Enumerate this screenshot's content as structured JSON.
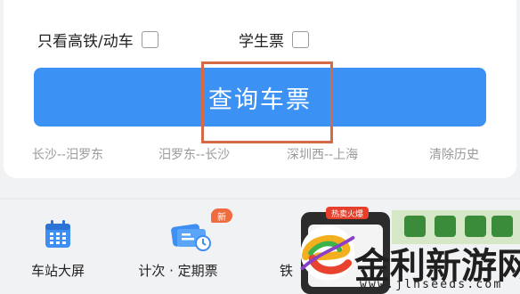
{
  "options": {
    "high_speed_only_label": "只看高铁/动车",
    "student_ticket_label": "学生票"
  },
  "query_button_label": "查询车票",
  "history": [
    "长沙--汨罗东",
    "汨罗东--长沙",
    "深圳西--上海",
    "清除历史"
  ],
  "tools": [
    {
      "label": "车站大屏",
      "icon": "calendar-icon"
    },
    {
      "label": "计次 · 定期票",
      "icon": "ticket-card-icon",
      "badge": "新"
    },
    {
      "label": "铁",
      "icon": "ad-thumbnail",
      "badge": "热卖火爆"
    }
  ],
  "watermark": {
    "name": "金利新游网",
    "url": "www.jlnseeds.com"
  },
  "colors": {
    "primary_blue": "#3c92f4",
    "highlight_border": "#d56a47",
    "badge_orange": "#f06b3e"
  }
}
